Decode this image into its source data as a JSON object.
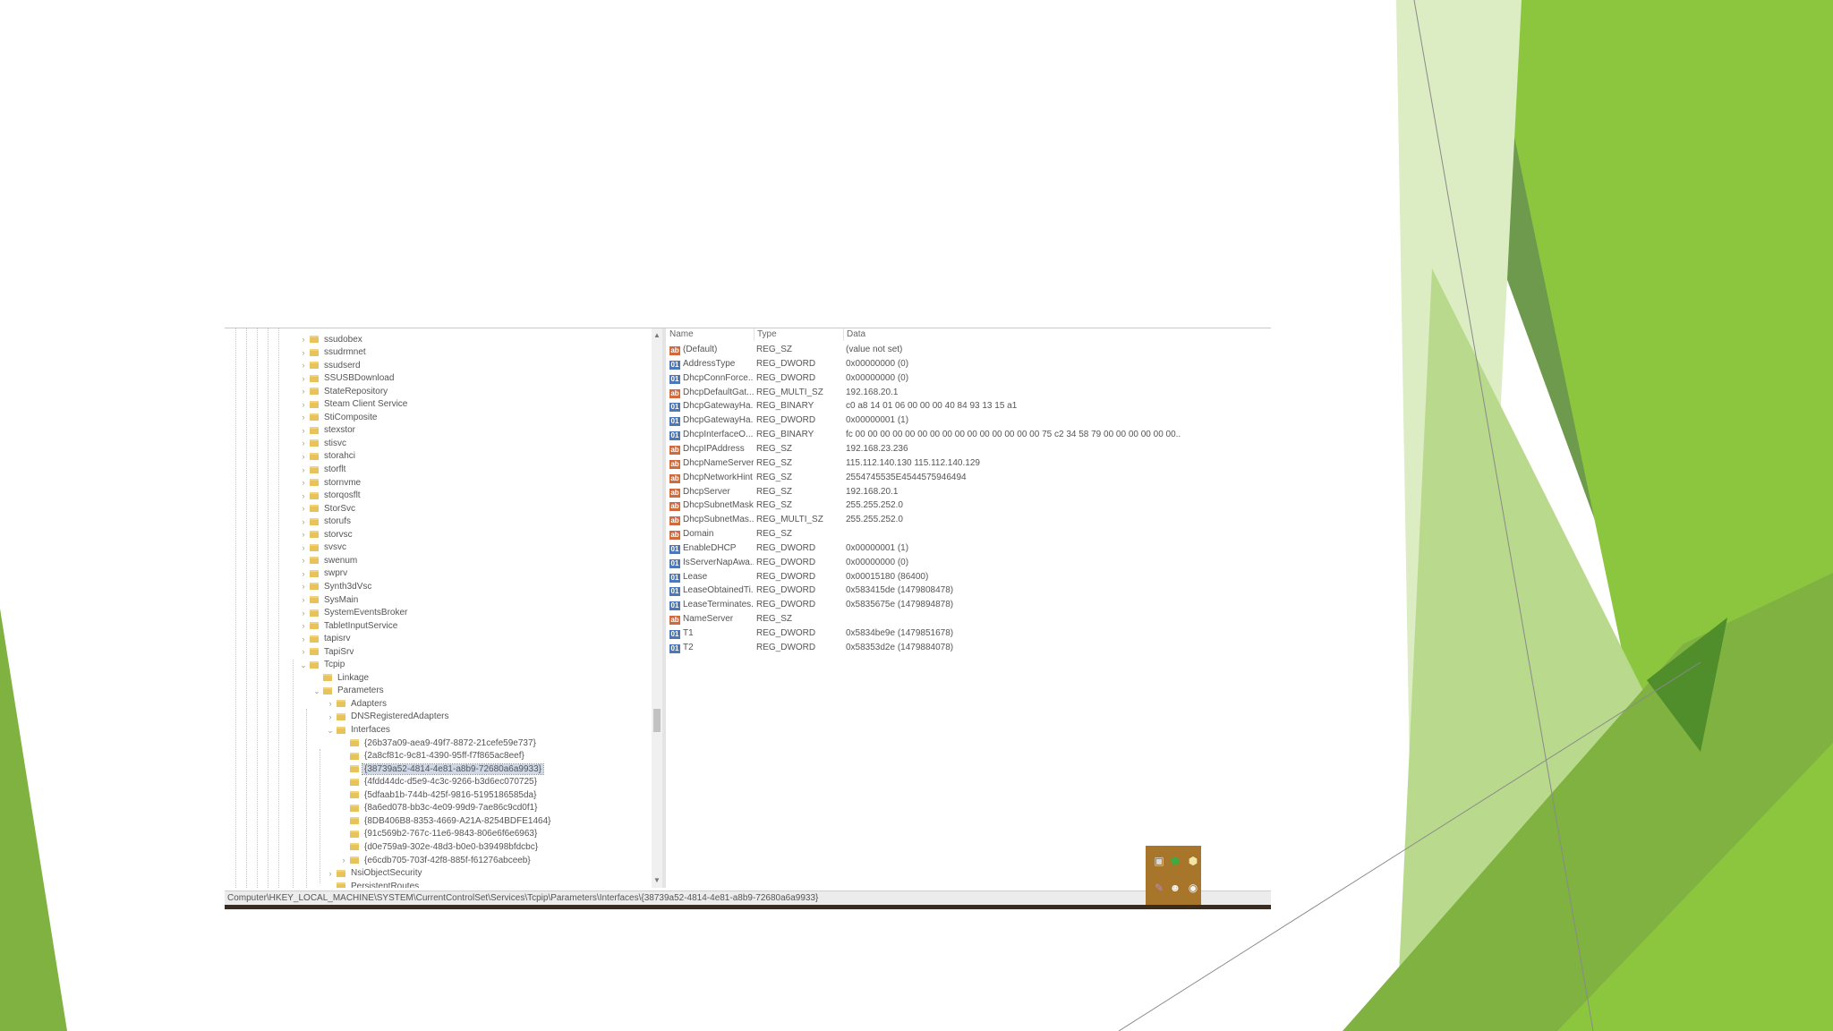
{
  "colors": {
    "bg_triangles": [
      "#6e9a4d",
      "#7fb241",
      "#8cc63f",
      "#b9d98c",
      "#dcecc3",
      "#4f8e2a"
    ],
    "selection": "#cfd8e6",
    "folder": "#e8c35c",
    "tray": "#a7762b"
  },
  "tree": {
    "items": [
      {
        "label": "ssudobex",
        "icon": "folder-icon",
        "chevron": "›"
      },
      {
        "label": "ssudrmnet",
        "icon": "folder-icon",
        "chevron": "›"
      },
      {
        "label": "ssudserd",
        "icon": "folder-icon",
        "chevron": "›"
      },
      {
        "label": "SSUSBDownload",
        "icon": "folder-icon",
        "chevron": "›"
      },
      {
        "label": "StateRepository",
        "icon": "folder-icon",
        "chevron": "›"
      },
      {
        "label": "Steam Client Service",
        "icon": "folder-icon",
        "chevron": "›"
      },
      {
        "label": "StiComposite",
        "icon": "folder-icon",
        "chevron": "›"
      },
      {
        "label": "stexstor",
        "icon": "folder-icon",
        "chevron": "›"
      },
      {
        "label": "stisvc",
        "icon": "folder-icon",
        "chevron": "›"
      },
      {
        "label": "storahci",
        "icon": "folder-icon",
        "chevron": "›"
      },
      {
        "label": "storflt",
        "icon": "folder-icon",
        "chevron": "›"
      },
      {
        "label": "stornvme",
        "icon": "folder-icon",
        "chevron": "›"
      },
      {
        "label": "storqosflt",
        "icon": "folder-icon",
        "chevron": "›"
      },
      {
        "label": "StorSvc",
        "icon": "folder-icon",
        "chevron": "›"
      },
      {
        "label": "storufs",
        "icon": "folder-icon",
        "chevron": "›"
      },
      {
        "label": "storvsc",
        "icon": "folder-icon",
        "chevron": "›"
      },
      {
        "label": "svsvc",
        "icon": "folder-icon",
        "chevron": "›"
      },
      {
        "label": "swenum",
        "icon": "folder-icon",
        "chevron": "›"
      },
      {
        "label": "swprv",
        "icon": "folder-icon",
        "chevron": "›"
      },
      {
        "label": "Synth3dVsc",
        "icon": "folder-icon",
        "chevron": "›"
      },
      {
        "label": "SysMain",
        "icon": "folder-icon",
        "chevron": "›"
      },
      {
        "label": "SystemEventsBroker",
        "icon": "folder-icon",
        "chevron": "›"
      },
      {
        "label": "TabletInputService",
        "icon": "folder-icon",
        "chevron": "›"
      },
      {
        "label": "tapisrv",
        "icon": "folder-icon",
        "chevron": "›"
      },
      {
        "label": "TapiSrv",
        "icon": "folder-icon",
        "chevron": "›"
      },
      {
        "label": "Tcpip",
        "icon": "folder-icon",
        "chevron": "⌄"
      },
      {
        "label": "Linkage",
        "icon": "folder-icon",
        "chevron": ""
      },
      {
        "label": "Parameters",
        "icon": "folder-icon",
        "chevron": "⌄"
      },
      {
        "label": "Adapters",
        "icon": "folder-icon",
        "chevron": "›"
      },
      {
        "label": "DNSRegisteredAdapters",
        "icon": "folder-icon",
        "chevron": "›"
      },
      {
        "label": "Interfaces",
        "icon": "folder-icon",
        "chevron": "⌄"
      },
      {
        "label": "{26b37a09-aea9-49f7-8872-21cefe59e737}",
        "icon": "folder-icon",
        "chevron": ""
      },
      {
        "label": "{2a8cf81c-9c81-4390-95ff-f7f865ac8eef}",
        "icon": "folder-icon",
        "chevron": ""
      },
      {
        "label": "{38739a52-4814-4e81-a8b9-72680a6a9933}",
        "icon": "folder-icon",
        "chevron": ""
      },
      {
        "label": "{4fdd44dc-d5e9-4c3c-9266-b3d6ec070725}",
        "icon": "folder-icon",
        "chevron": ""
      },
      {
        "label": "{5dfaab1b-744b-425f-9816-5195186585da}",
        "icon": "folder-icon",
        "chevron": ""
      },
      {
        "label": "{8a6ed078-bb3c-4e09-99d9-7ae86c9cd0f1}",
        "icon": "folder-icon",
        "chevron": ""
      },
      {
        "label": "{8DB406B8-8353-4669-A21A-8254BDFE1464}",
        "icon": "folder-icon",
        "chevron": ""
      },
      {
        "label": "{91c569b2-767c-11e6-9843-806e6f6e6963}",
        "icon": "folder-icon",
        "chevron": ""
      },
      {
        "label": "{d0e759a9-302e-48d3-b0e0-b39498bfdcbc}",
        "icon": "folder-icon",
        "chevron": ""
      },
      {
        "label": "{e6cdb705-703f-42f8-885f-f61276abceeb}",
        "icon": "folder-icon",
        "chevron": "›"
      },
      {
        "label": "NsiObjectSecurity",
        "icon": "folder-icon",
        "chevron": "›"
      },
      {
        "label": "PersistentRoutes",
        "icon": "folder-icon",
        "chevron": ""
      }
    ]
  },
  "values": {
    "columns": {
      "name": "Name",
      "type": "Type",
      "data": "Data"
    },
    "rows": [
      {
        "name": "(Default)",
        "type": "REG_SZ",
        "data": "(value not set)",
        "icon": "string-value-icon"
      },
      {
        "name": "AddressType",
        "type": "REG_DWORD",
        "data": "0x00000000 (0)",
        "icon": "binary-value-icon"
      },
      {
        "name": "DhcpConnForce...",
        "type": "REG_DWORD",
        "data": "0x00000000 (0)",
        "icon": "binary-value-icon"
      },
      {
        "name": "DhcpDefaultGat...",
        "type": "REG_MULTI_SZ",
        "data": "192.168.20.1",
        "icon": "string-value-icon"
      },
      {
        "name": "DhcpGatewayHa...",
        "type": "REG_BINARY",
        "data": "c0 a8 14 01 06 00 00 00 40 84 93 13 15 a1",
        "icon": "binary-value-icon"
      },
      {
        "name": "DhcpGatewayHa...",
        "type": "REG_DWORD",
        "data": "0x00000001 (1)",
        "icon": "binary-value-icon"
      },
      {
        "name": "DhcpInterfaceO...",
        "type": "REG_BINARY",
        "data": "fc 00 00 00 00 00 00 00 00 00 00 00 00 00 00 00 75 c2 34 58 79 00 00 00 00 00 00...",
        "icon": "binary-value-icon"
      },
      {
        "name": "DhcpIPAddress",
        "type": "REG_SZ",
        "data": "192.168.23.236",
        "icon": "string-value-icon"
      },
      {
        "name": "DhcpNameServer",
        "type": "REG_SZ",
        "data": "115.112.140.130 115.112.140.129",
        "icon": "string-value-icon"
      },
      {
        "name": "DhcpNetworkHint",
        "type": "REG_SZ",
        "data": "2554745535E4544575946494",
        "icon": "string-value-icon"
      },
      {
        "name": "DhcpServer",
        "type": "REG_SZ",
        "data": "192.168.20.1",
        "icon": "string-value-icon"
      },
      {
        "name": "DhcpSubnetMask",
        "type": "REG_SZ",
        "data": "255.255.252.0",
        "icon": "string-value-icon"
      },
      {
        "name": "DhcpSubnetMas...",
        "type": "REG_MULTI_SZ",
        "data": "255.255.252.0",
        "icon": "string-value-icon"
      },
      {
        "name": "Domain",
        "type": "REG_SZ",
        "data": "",
        "icon": "string-value-icon"
      },
      {
        "name": "EnableDHCP",
        "type": "REG_DWORD",
        "data": "0x00000001 (1)",
        "icon": "binary-value-icon"
      },
      {
        "name": "IsServerNapAwa...",
        "type": "REG_DWORD",
        "data": "0x00000000 (0)",
        "icon": "binary-value-icon"
      },
      {
        "name": "Lease",
        "type": "REG_DWORD",
        "data": "0x00015180 (86400)",
        "icon": "binary-value-icon"
      },
      {
        "name": "LeaseObtainedTi...",
        "type": "REG_DWORD",
        "data": "0x583415de (1479808478)",
        "icon": "binary-value-icon"
      },
      {
        "name": "LeaseTerminates...",
        "type": "REG_DWORD",
        "data": "0x5835675e (1479894878)",
        "icon": "binary-value-icon"
      },
      {
        "name": "NameServer",
        "type": "REG_SZ",
        "data": "",
        "icon": "string-value-icon"
      },
      {
        "name": "T1",
        "type": "REG_DWORD",
        "data": "0x5834be9e (1479851678)",
        "icon": "binary-value-icon"
      },
      {
        "name": "T2",
        "type": "REG_DWORD",
        "data": "0x58353d2e (1479884078)",
        "icon": "binary-value-icon"
      }
    ]
  },
  "statusbar": {
    "path": "Computer\\HKEY_LOCAL_MACHINE\\SYSTEM\\CurrentControlSet\\Services\\Tcpip\\Parameters\\Interfaces\\{38739a52-4814-4e81-a8b9-72680a6a9933}"
  },
  "tray": {
    "icons": [
      "monitor-icon",
      "shield-green-icon",
      "shield-yellow-icon",
      "pen-icon",
      "people-icon",
      "steam-icon"
    ]
  }
}
